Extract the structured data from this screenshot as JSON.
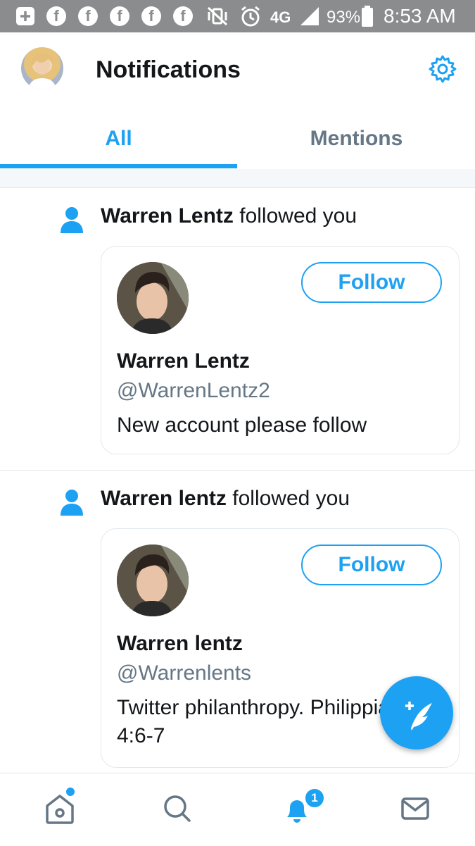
{
  "status_bar": {
    "network": "4G",
    "battery": "93%",
    "time": "8:53 AM",
    "icons": [
      "plus-box-icon",
      "facebook-icon",
      "facebook-icon",
      "facebook-icon",
      "facebook-icon",
      "facebook-icon",
      "vibrate-off-icon",
      "alarm-icon",
      "signal-icon",
      "battery-icon"
    ]
  },
  "header": {
    "title": "Notifications",
    "settings_icon": "gear-icon"
  },
  "tabs": [
    {
      "label": "All",
      "active": true
    },
    {
      "label": "Mentions",
      "active": false
    }
  ],
  "notifications": [
    {
      "icon": "person-icon",
      "actor": "Warren Lentz",
      "action": "followed you",
      "card": {
        "name": "Warren Lentz",
        "handle": "@WarrenLentz2",
        "bio": "New account please follow",
        "follow_label": "Follow"
      }
    },
    {
      "icon": "person-icon",
      "actor": "Warren lentz",
      "action": "followed you",
      "card": {
        "name": "Warren lentz",
        "handle": "@Warrenlents",
        "bio": "Twitter philanthropy. Philippians 4:6-7",
        "follow_label": "Follow"
      }
    }
  ],
  "fab": {
    "icon": "compose-tweet-icon"
  },
  "bottom_nav": {
    "items": [
      "home-icon",
      "search-icon",
      "notifications-bell-icon",
      "messages-icon"
    ],
    "notifications_badge": "1"
  },
  "colors": {
    "accent": "#1da1f2",
    "secondary_text": "#657786",
    "status_bar": "#8a8c8e"
  }
}
